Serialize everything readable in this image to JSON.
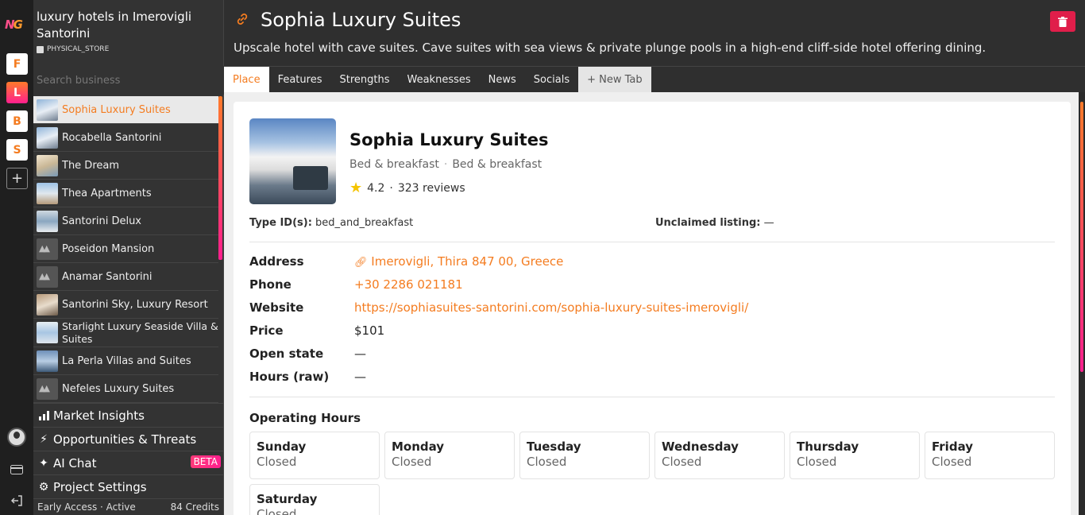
{
  "rail": {
    "logo": "NG",
    "projects": [
      {
        "letter": "F",
        "active": false
      },
      {
        "letter": "L",
        "active": true
      },
      {
        "letter": "B",
        "active": false
      },
      {
        "letter": "S",
        "active": false
      }
    ],
    "add_icon": "+"
  },
  "sidebar": {
    "title": "luxury hotels in Imerovigli Santorini",
    "type": "PHYSICAL_STORE",
    "search_placeholder": "Search business",
    "items": [
      {
        "label": "Sophia Luxury Suites",
        "active": true,
        "thumb": "photo"
      },
      {
        "label": "Rocabella Santorini",
        "active": false,
        "thumb": "photo"
      },
      {
        "label": "The Dream",
        "active": false,
        "thumb": "photo"
      },
      {
        "label": "Thea Apartments",
        "active": false,
        "thumb": "photo"
      },
      {
        "label": "Santorini Delux",
        "active": false,
        "thumb": "photo"
      },
      {
        "label": "Poseidon Mansion",
        "active": false,
        "thumb": "placeholder"
      },
      {
        "label": "Anamar Santorini",
        "active": false,
        "thumb": "placeholder"
      },
      {
        "label": "Santorini Sky, Luxury Resort",
        "active": false,
        "thumb": "photo"
      },
      {
        "label": "Starlight Luxury Seaside Villa & Suites",
        "active": false,
        "thumb": "photo"
      },
      {
        "label": "La Perla Villas and Suites",
        "active": false,
        "thumb": "photo"
      },
      {
        "label": "Nefeles Luxury Suites",
        "active": false,
        "thumb": "placeholder"
      }
    ],
    "menu": {
      "market_insights": "Market Insights",
      "opportunities": "Opportunities & Threats",
      "ai_chat": "AI Chat",
      "beta": "BETA",
      "settings": "Project Settings"
    },
    "status": {
      "access": "Early Access · Active",
      "credits": "84 Credits"
    }
  },
  "header": {
    "title": "Sophia Luxury Suites",
    "description": "Upscale hotel with cave suites. Cave suites with sea views & private plunge pools in a high-end cliff-side hotel offering dining."
  },
  "tabs": [
    "Place",
    "Features",
    "Strengths",
    "Weaknesses",
    "News",
    "Socials",
    "+ New Tab"
  ],
  "place": {
    "name": "Sophia Luxury Suites",
    "category1": "Bed & breakfast",
    "category2": "Bed & breakfast",
    "rating": "4.2",
    "reviews": "323 reviews",
    "type_label": "Type ID(s):",
    "type_value": "bed_and_breakfast",
    "unclaimed_label": "Unclaimed listing:",
    "unclaimed_value": "—",
    "info": {
      "address_label": "Address",
      "address": "Imerovigli, Thira 847 00, Greece",
      "phone_label": "Phone",
      "phone": "+30 2286 021181",
      "website_label": "Website",
      "website": "https://sophiasuites-santorini.com/sophia-luxury-suites-imerovigli/",
      "price_label": "Price",
      "price": "$101",
      "open_label": "Open state",
      "open": "—",
      "hours_label": "Hours (raw)",
      "hours": "—"
    },
    "operating_hours_title": "Operating Hours",
    "hours": [
      {
        "day": "Sunday",
        "status": "Closed"
      },
      {
        "day": "Monday",
        "status": "Closed"
      },
      {
        "day": "Tuesday",
        "status": "Closed"
      },
      {
        "day": "Wednesday",
        "status": "Closed"
      },
      {
        "day": "Thursday",
        "status": "Closed"
      },
      {
        "day": "Friday",
        "status": "Closed"
      },
      {
        "day": "Saturday",
        "status": "Closed"
      }
    ]
  },
  "colors": {
    "accent": "#f47c20",
    "brand_pink": "#ff1f8e",
    "delete": "#e01e4a"
  }
}
